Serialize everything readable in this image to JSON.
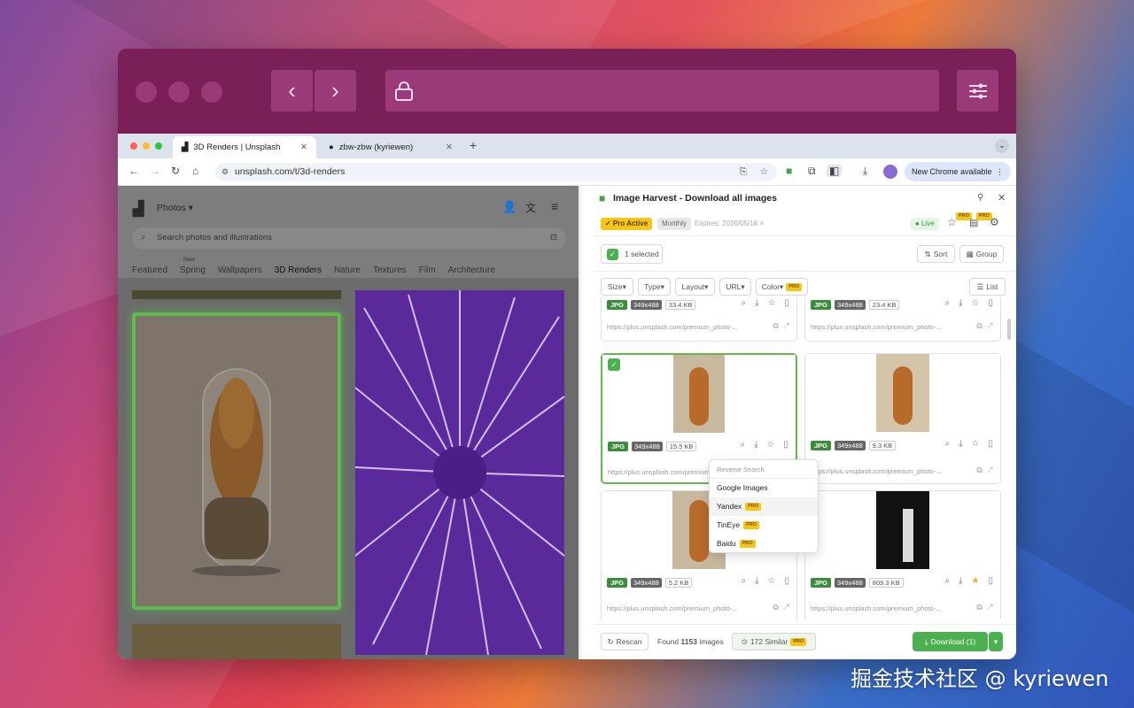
{
  "browser": {
    "tabs": [
      {
        "label": "3D Renders | Unsplash"
      },
      {
        "label": "zbw-zbw (kyriewen)"
      }
    ],
    "url": "unsplash.com/t/3d-renders",
    "new_chrome": "New Chrome available"
  },
  "unsplash": {
    "menu_label": "Photos",
    "search_placeholder": "Search photos and illustrations",
    "new_badge": "New",
    "categories": [
      "Featured",
      "Spring",
      "Wallpapers",
      "3D Renders",
      "Nature",
      "Textures",
      "Film",
      "Architecture"
    ]
  },
  "panel": {
    "title": "Image Harvest - Download all images",
    "pro_active": "✓ Pro Active",
    "plan": "Monthly",
    "expires": "Expires: 2026/05/16",
    "live": "● Live",
    "selected": "1 selected",
    "sort": "Sort",
    "group": "Group",
    "filters": [
      "Size▾",
      "Type▾",
      "Layout▾",
      "URL▾",
      "Color▾"
    ],
    "list": "List",
    "pro_tag": "PRO",
    "cards": [
      {
        "type": "JPG",
        "dim": "349x488",
        "size": "33.4 KB",
        "url": "https://plus.unsplash.com/premium_photo-..."
      },
      {
        "type": "JPG",
        "dim": "349x488",
        "size": "23.4 KB",
        "url": "https://plus.unsplash.com/premium_photo-..."
      },
      {
        "type": "JPG",
        "dim": "349x488",
        "size": "15.5 KB",
        "url": "https://plus.unsplash.com/premium_photo-..."
      },
      {
        "type": "JPG",
        "dim": "349x488",
        "size": "9.3 KB",
        "url": "https://plus.unsplash.com/premium_photo-..."
      },
      {
        "type": "JPG",
        "dim": "349x488",
        "size": "5.2 KB",
        "url": "https://plus.unsplash.com/premium_photo-..."
      },
      {
        "type": "JPG",
        "dim": "349x488",
        "size": "809.3 KB",
        "url": "https://plus.unsplash.com/premium_photo-..."
      }
    ],
    "reverse_menu": {
      "header": "Reverse Search",
      "items": [
        "Google Images",
        "Yandex",
        "TinEye",
        "Baidu"
      ]
    },
    "footer": {
      "rescan": "Rescan",
      "found": "Found",
      "count": "1153",
      "images": "images",
      "similar": "172 Similar",
      "download": "Download (1)"
    }
  },
  "watermark": "掘金技术社区 @ kyriewen"
}
